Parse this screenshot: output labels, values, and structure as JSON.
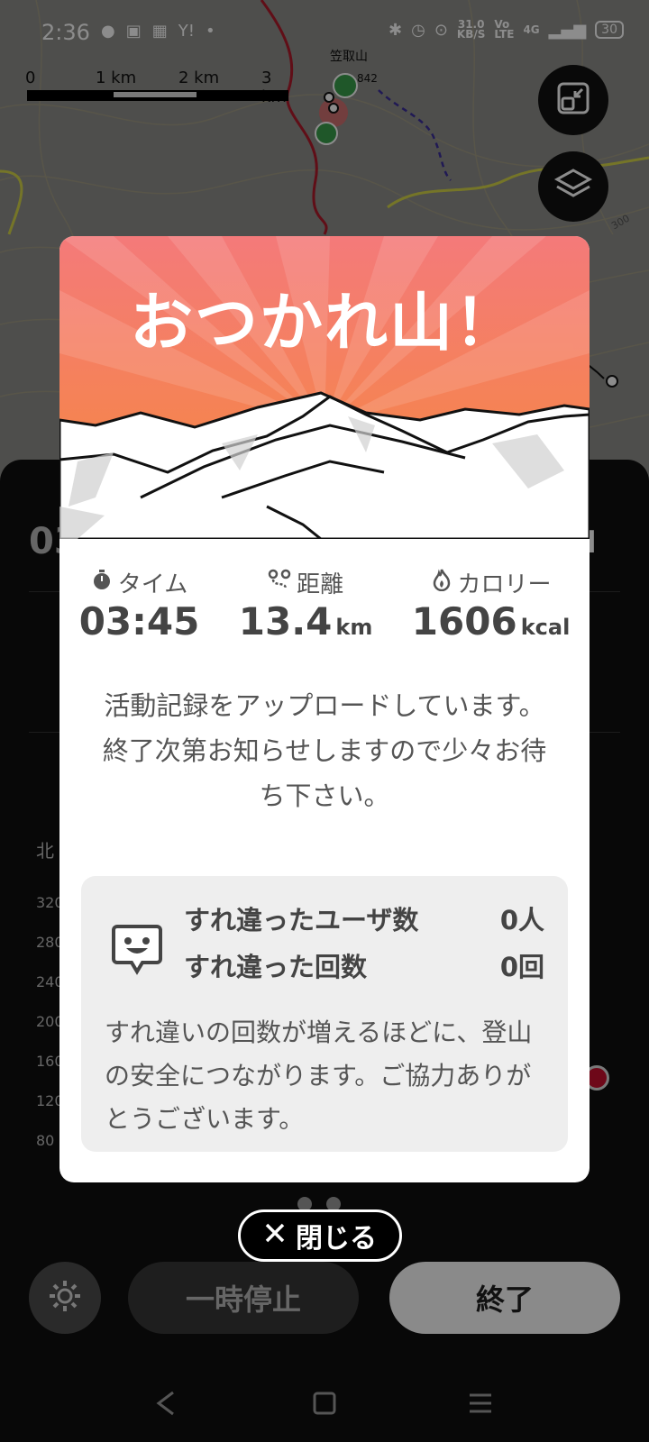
{
  "status_bar": {
    "time": "2:36",
    "left_icons": [
      "line-icon",
      "app-icon",
      "calendar-icon",
      "yahoo-icon",
      "dot-icon"
    ],
    "yahoo": "Y!",
    "speed_value": "31.0",
    "speed_unit": "KB/S",
    "volte": "Vo\nLTE",
    "network": "4G",
    "battery": "30"
  },
  "map": {
    "scale_labels": [
      "0",
      "1 km",
      "2 km",
      "3 km"
    ],
    "peak_name": "笠取山",
    "elevation_label": "842",
    "contour_label": "300",
    "buttons": [
      "collapse-map-icon",
      "layers-icon"
    ]
  },
  "background_panel": {
    "time_partial": "03",
    "compass_partial": "N",
    "side_label": "北",
    "axis_values": [
      "320",
      "280",
      "240",
      "200",
      "160",
      "120",
      "80"
    ]
  },
  "dialog": {
    "title": "おつかれ山！",
    "stats": [
      {
        "icon": "stopwatch-icon",
        "label": "タイム",
        "value": "03:45",
        "unit": ""
      },
      {
        "icon": "route-icon",
        "label": "距離",
        "value": "13.4",
        "unit": "km"
      },
      {
        "icon": "flame-icon",
        "label": "カロリー",
        "value": "1606",
        "unit": "kcal"
      }
    ],
    "message_line1": "活動記録をアップロードしています。",
    "message_line2": "終了次第お知らせしますので少々お待ち下さい。",
    "encounter": {
      "icon": "face-bubble-icon",
      "users_label": "すれ違ったユーザ数",
      "users_value": "0人",
      "count_label": "すれ違った回数",
      "count_value": "0回",
      "note": "すれ違いの回数が増えるほどに、登山の安全につながります。ご協力ありがとうございます。"
    }
  },
  "page_dots": 2,
  "close_button": "閉じる",
  "controls": {
    "settings_icon": "gear-icon",
    "pause": "一時停止",
    "end": "終了"
  },
  "nav": [
    "back-icon",
    "home-icon",
    "menu-icon"
  ],
  "colors": {
    "banner_top": "#f47a7a",
    "banner_bottom": "#f6893a",
    "dialog_bg": "#ffffff",
    "box_bg": "#eeeeee"
  }
}
